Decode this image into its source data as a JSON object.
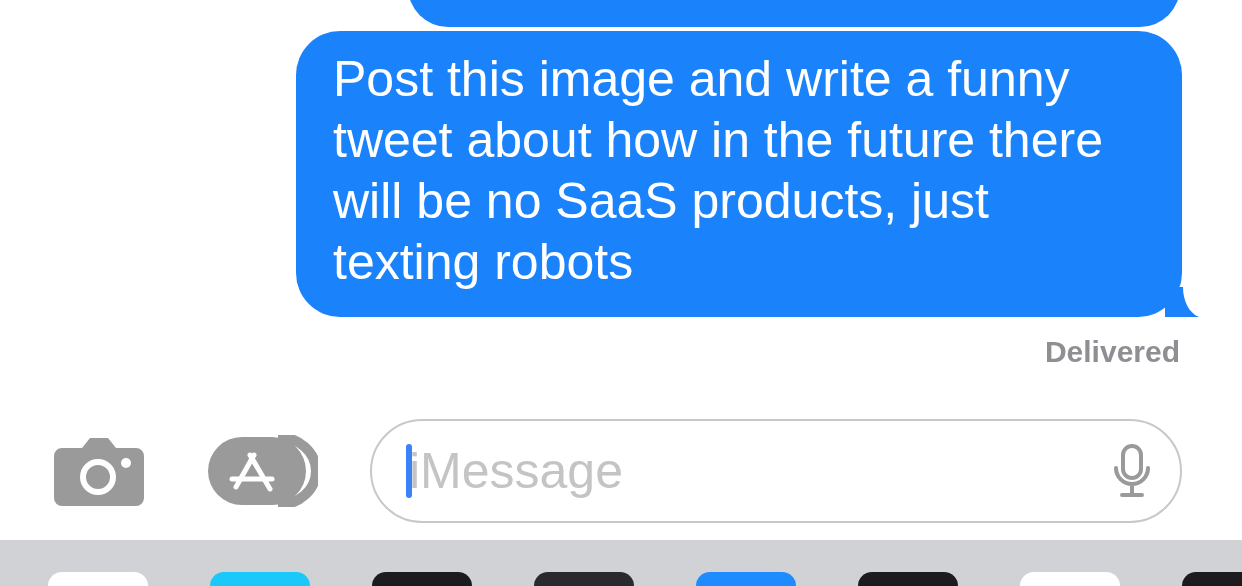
{
  "messages": [
    {
      "kind": "cut"
    },
    {
      "kind": "sent",
      "text": "Post this image and write a funny\ntweet about how in the future there\nwill be no SaaS products, just\ntexting robots",
      "status": "Delivered"
    }
  ],
  "composer": {
    "placeholder": "iMessage"
  },
  "app_drawer": {
    "apps": [
      {
        "color": "#ffffff"
      },
      {
        "color": "#1ac8fa"
      },
      {
        "color": "#1c1c1e"
      },
      {
        "color": "#2a2a2c"
      },
      {
        "color": "#1e8cff"
      },
      {
        "color": "#1c1c1e"
      },
      {
        "color": "#ffffff"
      },
      {
        "color": "#1c1c1e"
      }
    ]
  }
}
